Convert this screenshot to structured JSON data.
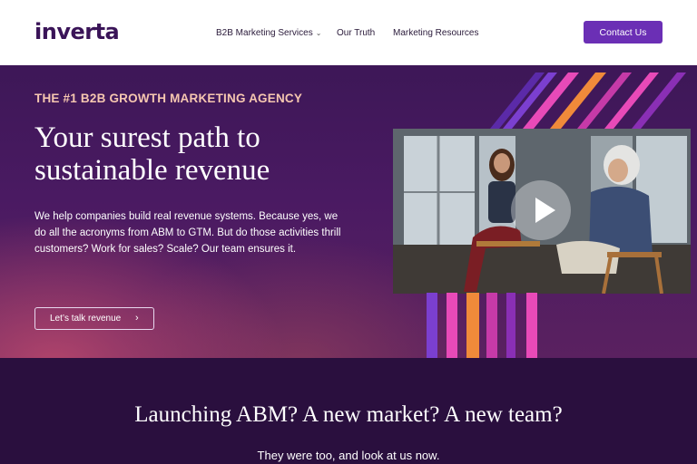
{
  "brand": {
    "logo_text": "inverta"
  },
  "nav": {
    "items": [
      {
        "label": "B2B Marketing Services",
        "has_dropdown": true
      },
      {
        "label": "Our Truth",
        "has_dropdown": false
      },
      {
        "label": "Marketing Resources",
        "has_dropdown": false
      }
    ],
    "dropdown_icon": "chevron-down-icon",
    "contact_label": "Contact Us"
  },
  "hero": {
    "eyebrow": "THE #1 B2B GROWTH MARKETING AGENCY",
    "headline": "Your surest path to sustainable revenue",
    "body": "We help companies build real revenue systems. Because yes, we do all the acronyms from ABM to GTM. But do those activities thrill customers? Work for sales? Scale? Our team ensures it.",
    "cta_label": "Let’s talk revenue",
    "cta_icon": "chevron-right-icon",
    "video_icon": "play-icon"
  },
  "lower": {
    "title": "Launching ABM? A new market? A new team?",
    "subtitle": "They were too, and look at us now."
  },
  "colors": {
    "brand_purple": "#6b2fb5",
    "deep_purple": "#2a0f3e",
    "eyebrow": "#f6c7b0",
    "stripe_pink": "#e84ab8",
    "stripe_orange": "#f08a3a",
    "stripe_purple": "#7b3fd0"
  }
}
